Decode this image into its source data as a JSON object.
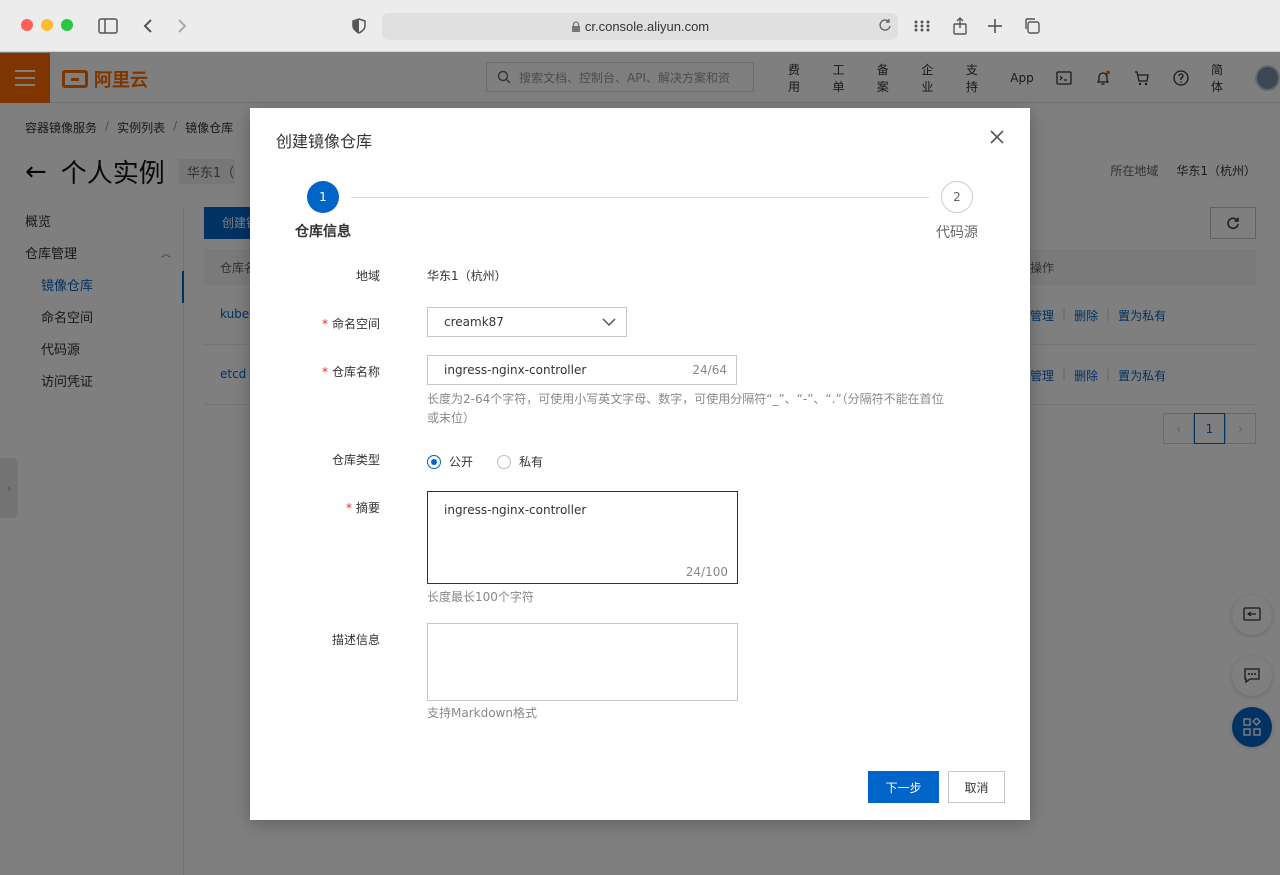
{
  "browser": {
    "url": "cr.console.aliyun.com"
  },
  "topnav": {
    "logo_text": "阿里云",
    "search_placeholder": "搜索文档、控制台、API、解决方案和资",
    "items": [
      "费用",
      "工单",
      "备案",
      "企业",
      "支持",
      "App"
    ],
    "lang": "简体",
    "accent_color": "#ff6a00"
  },
  "breadcrumb": [
    "容器镜像服务",
    "实例列表",
    "镜像仓库"
  ],
  "page": {
    "title": "个人实例",
    "region_pill": "华东1（杭州）",
    "region_label": "所在地域",
    "region_value": "华东1（杭州）"
  },
  "sidebar": {
    "items": [
      {
        "label": "概览"
      },
      {
        "label": "仓库管理"
      },
      {
        "label": "镜像仓库"
      },
      {
        "label": "命名空间"
      },
      {
        "label": "代码源"
      },
      {
        "label": "访问凭证"
      }
    ]
  },
  "table": {
    "create_button": "创建镜像仓库",
    "col_name": "仓库名称",
    "col_ops": "操作",
    "rows": [
      {
        "name": "kube-",
        "ops": [
          "管理",
          "删除",
          "置为私有"
        ]
      },
      {
        "name": "etcd",
        "ops": [
          "管理",
          "删除",
          "置为私有"
        ]
      }
    ],
    "current_page": "1"
  },
  "dialog": {
    "title": "创建镜像仓库",
    "steps": [
      {
        "num": "1",
        "label": "仓库信息"
      },
      {
        "num": "2",
        "label": "代码源"
      }
    ],
    "fields": {
      "region": {
        "label": "地域",
        "value": "华东1（杭州）"
      },
      "namespace": {
        "label": "命名空间",
        "value": "creamk87"
      },
      "repo_name": {
        "label": "仓库名称",
        "value": "ingress-nginx-controller",
        "counter": "24/64",
        "help": "长度为2-64个字符，可使用小写英文字母、数字，可使用分隔符“_”、“-”、“.”（分隔符不能在首位或末位）"
      },
      "repo_type": {
        "label": "仓库类型",
        "options": [
          "公开",
          "私有"
        ],
        "selected": "公开"
      },
      "summary": {
        "label": "摘要",
        "value": "ingress-nginx-controller",
        "counter": "24/100",
        "help": "长度最长100个字符"
      },
      "description": {
        "label": "描述信息",
        "value": "",
        "help": "支持Markdown格式"
      }
    },
    "next_button": "下一步",
    "cancel_button": "取消",
    "primary_color": "#0064c8"
  }
}
